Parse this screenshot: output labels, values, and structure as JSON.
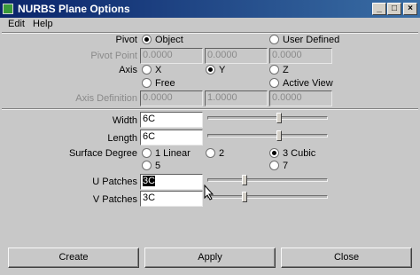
{
  "window": {
    "title": "NURBS Plane Options"
  },
  "menu": {
    "edit": "Edit",
    "help": "Help"
  },
  "pivot": {
    "label": "Pivot",
    "option_object": "Object",
    "option_user_defined": "User Defined",
    "selected": "Object"
  },
  "pivot_point": {
    "label": "Pivot Point",
    "values": [
      "0.0000",
      "0.0000",
      "0.0000"
    ]
  },
  "axis": {
    "label": "Axis",
    "options": [
      "X",
      "Y",
      "Z",
      "Free",
      "Active View"
    ],
    "selected": "Y"
  },
  "axis_definition": {
    "label": "Axis Definition",
    "values": [
      "0.0000",
      "1.0000",
      "0.0000"
    ]
  },
  "width": {
    "label": "Width",
    "value": "6C",
    "slider_fraction": 0.6
  },
  "length": {
    "label": "Length",
    "value": "6C",
    "slider_fraction": 0.6
  },
  "surface_degree": {
    "label": "Surface Degree",
    "options": [
      "1 Linear",
      "2",
      "3 Cubic",
      "5",
      "7"
    ],
    "selected": "3 Cubic"
  },
  "u_patches": {
    "label": "U Patches",
    "value": "3C",
    "slider_fraction": 0.3
  },
  "v_patches": {
    "label": "V Patches",
    "value": "3C",
    "slider_fraction": 0.3
  },
  "buttons": {
    "create": "Create",
    "apply": "Apply",
    "close": "Close"
  }
}
